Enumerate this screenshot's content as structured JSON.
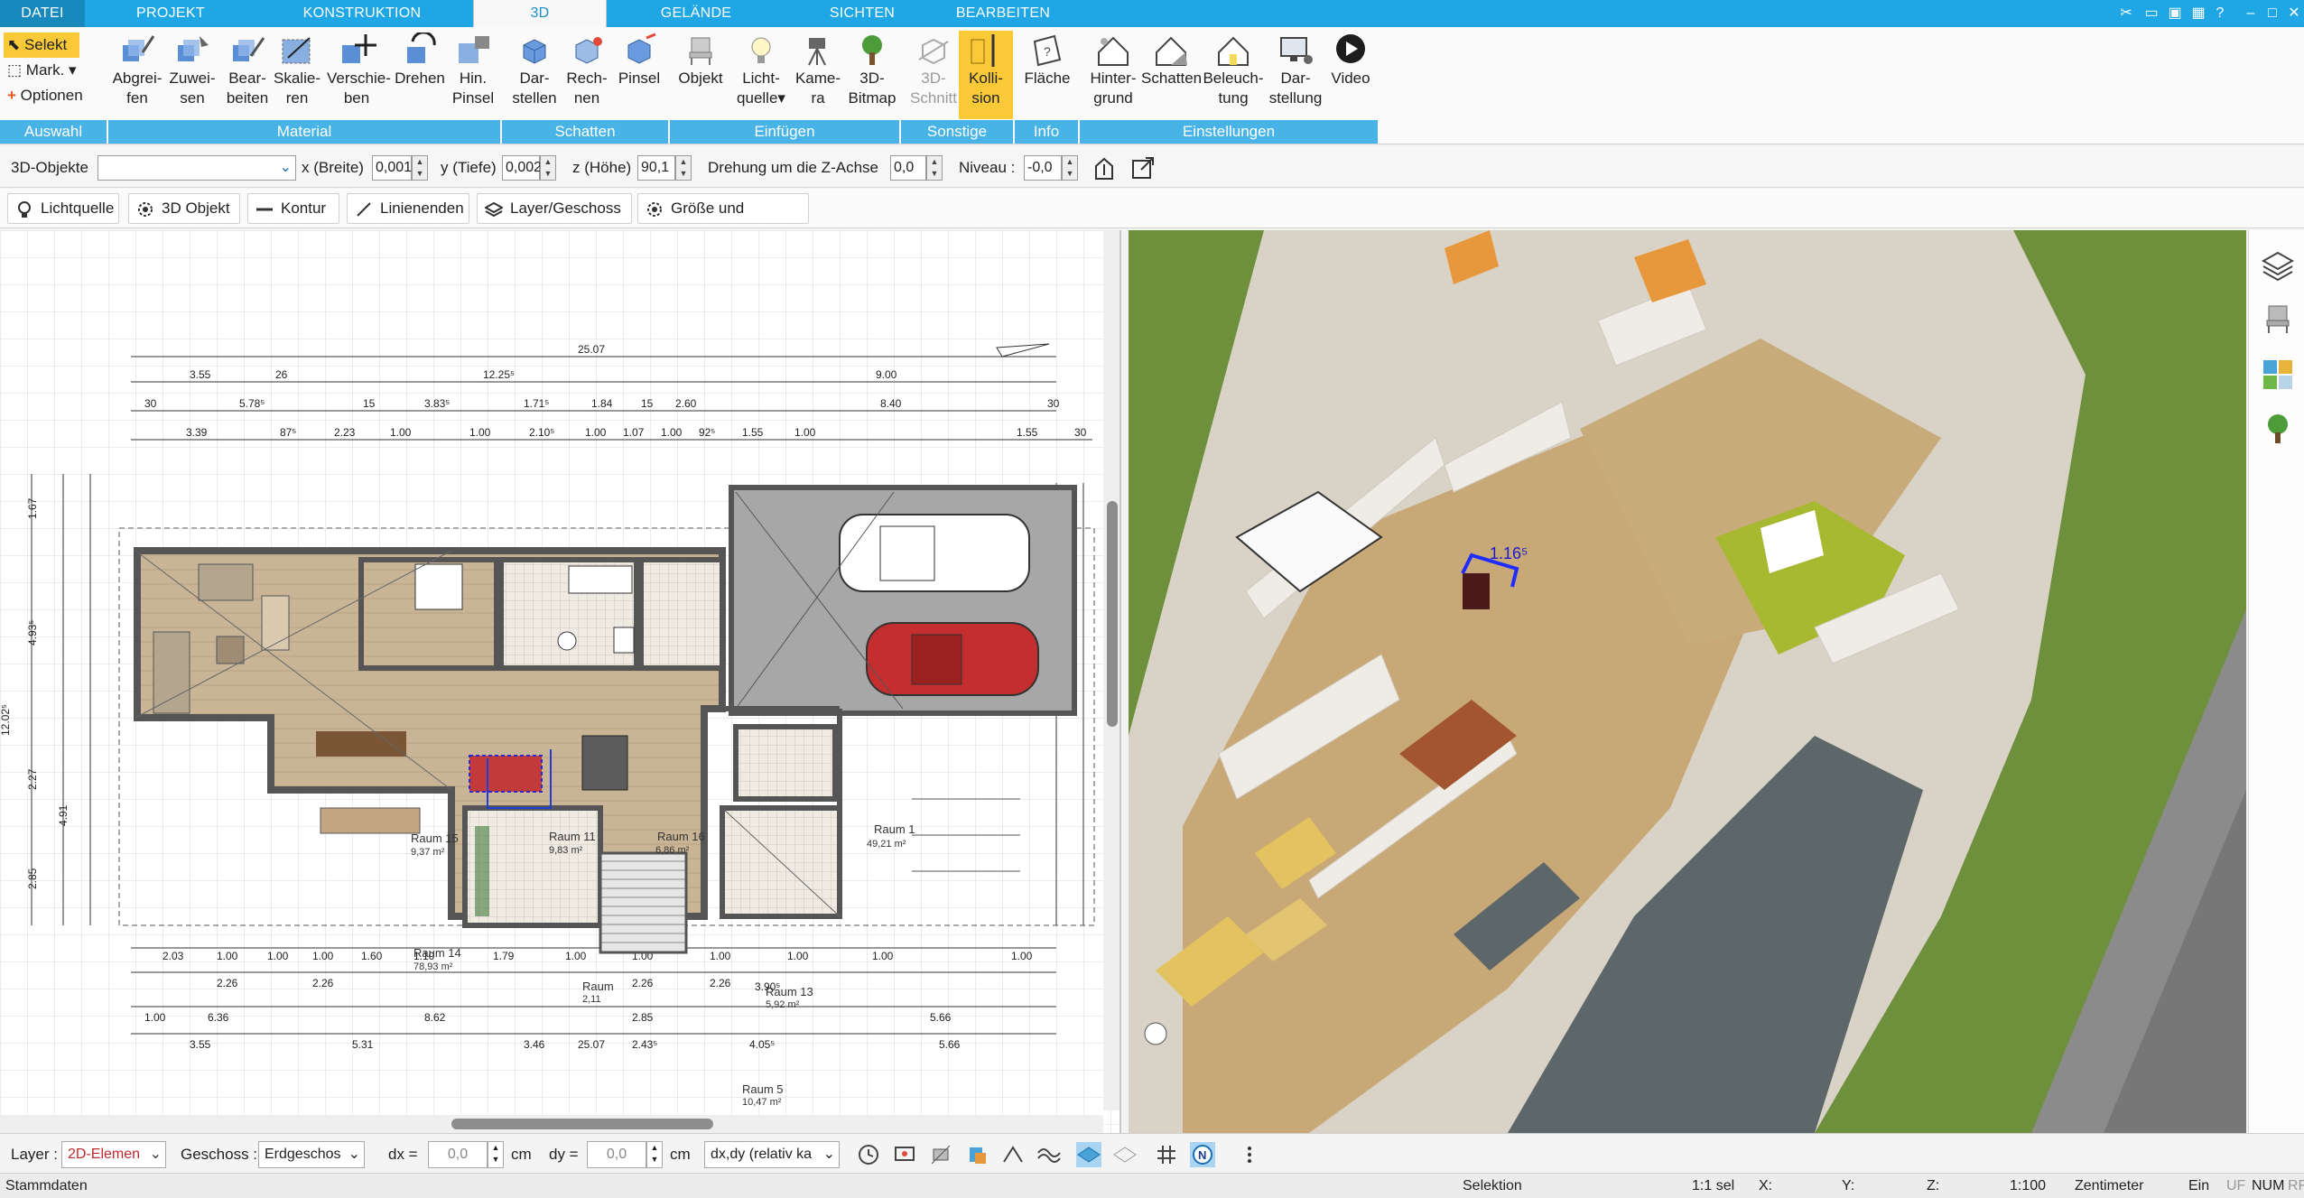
{
  "menu": {
    "tabs": [
      {
        "label": "DATEI"
      },
      {
        "label": "PROJEKT"
      },
      {
        "label": "KONSTRUKTION"
      },
      {
        "label": "3D"
      },
      {
        "label": "GELÄNDE"
      },
      {
        "label": "SICHTEN"
      },
      {
        "label": "BEARBEITEN"
      }
    ],
    "active_tab": "3D"
  },
  "ribbon": {
    "auswahl": {
      "select": "Selekt",
      "mark": "Mark.",
      "options": "Optionen",
      "group": "Auswahl"
    },
    "material": {
      "group": "Material",
      "buttons": [
        {
          "l1": "Abgrei-",
          "l2": "fen"
        },
        {
          "l1": "Zuwei-",
          "l2": "sen"
        },
        {
          "l1": "Bear-",
          "l2": "beiten"
        },
        {
          "l1": "Skalie-",
          "l2": "ren"
        },
        {
          "l1": "Verschie-",
          "l2": "ben"
        },
        {
          "l1": "Drehen",
          "l2": ""
        },
        {
          "l1": "Hin.",
          "l2": "Pinsel"
        }
      ]
    },
    "schatten": {
      "group": "Schatten",
      "buttons": [
        {
          "l1": "Dar-",
          "l2": "stellen"
        },
        {
          "l1": "Rech-",
          "l2": "nen"
        },
        {
          "l1": "Pinsel",
          "l2": ""
        }
      ]
    },
    "einfuegen": {
      "group": "Einfügen",
      "buttons": [
        {
          "l1": "Objekt",
          "l2": ""
        },
        {
          "l1": "Licht-",
          "l2": "quelle"
        },
        {
          "l1": "Kame-",
          "l2": "ra"
        },
        {
          "l1": "3D-",
          "l2": "Bitmap"
        }
      ]
    },
    "sonstige": {
      "group": "Sonstige",
      "buttons": [
        {
          "l1": "3D-",
          "l2": "Schnitt"
        },
        {
          "l1": "Kolli-",
          "l2": "sion"
        }
      ]
    },
    "info": {
      "group": "Info",
      "buttons": [
        {
          "l1": "Fläche",
          "l2": ""
        }
      ]
    },
    "einstellungen": {
      "group": "Einstellungen",
      "buttons": [
        {
          "l1": "Hinter-",
          "l2": "grund"
        },
        {
          "l1": "Schatten",
          "l2": ""
        },
        {
          "l1": "Beleuch-",
          "l2": "tung"
        },
        {
          "l1": "Dar-",
          "l2": "stellung"
        },
        {
          "l1": "Video",
          "l2": ""
        }
      ]
    }
  },
  "props": {
    "objects_label": "3D-Objekte",
    "objects_value": "",
    "x_label": "x (Breite)",
    "x_value": "0,001",
    "y_label": "y (Tiefe)",
    "y_value": "0,002",
    "z_label": "z (Höhe)",
    "z_value": "90,1",
    "rot_label": "Drehung um die Z-Achse",
    "rot_value": "0,0",
    "niveau_label": "Niveau :",
    "niveau_value": "-0,0"
  },
  "tools": [
    {
      "label": "Lichtquelle"
    },
    {
      "label": "3D Objekt"
    },
    {
      "label": "Kontur"
    },
    {
      "label": "Linienenden"
    },
    {
      "label": "Layer/Geschoss"
    },
    {
      "label": "Größe und Position"
    }
  ],
  "plan": {
    "rooms": [
      {
        "name": "Raum 1",
        "area": "49,21 m²"
      },
      {
        "name": "Raum 15",
        "area": "9,37 m²"
      },
      {
        "name": "Raum 11",
        "area": "9,83 m²"
      },
      {
        "name": "Raum 16",
        "area": "6,86 m²"
      },
      {
        "name": "Raum 14",
        "area": "78,93 m²"
      },
      {
        "name": "Raum 13",
        "area": "5,92 m²"
      },
      {
        "name": "Raum 5",
        "area": "10,47 m²"
      },
      {
        "name": "Raum",
        "area": "2,11"
      }
    ],
    "dims_top": [
      "25.07",
      "3.55",
      "26",
      "12.25⁵",
      "9.00",
      "30",
      "5.78⁵",
      "15",
      "3.83⁵",
      "1.71⁵",
      "1.84",
      "15",
      "2.60",
      "8.40",
      "30",
      "3.39",
      "87⁵",
      "2.23",
      "1.00",
      "1.00",
      "2.10⁵",
      "1.00",
      "1.07",
      "1.00",
      "92⁵",
      "1.55",
      "1.00",
      "1.55",
      "30"
    ],
    "dims_bottom": [
      "2.03",
      "1.00",
      "1.00",
      "1.00",
      "1.60",
      "1.10",
      "1.79",
      "1.00",
      "1.00",
      "1.00",
      "1.00",
      "1.00",
      "1.00",
      "2.26",
      "2.26",
      "2.26",
      "2.26",
      "3.90⁵",
      "1.00",
      "6.36",
      "8.62",
      "2.85",
      "5.66",
      "3.55",
      "5.31",
      "3.46",
      "2.43⁵",
      "4.05⁵",
      "5.66",
      "25.07"
    ],
    "dims_left": [
      "1.67",
      "4.93⁵",
      "12.02⁵",
      "2.27",
      "4.91",
      "2.85"
    ],
    "measure": "1.16⁵"
  },
  "bottom": {
    "layer_label": "Layer :",
    "layer_value": "2D-Elemen",
    "floor_label": "Geschoss :",
    "floor_value": "Erdgeschos",
    "dx_label": "dx =",
    "dx_value": "0,0",
    "cm1": "cm",
    "dy_label": "dy =",
    "dy_value": "0,0",
    "cm2": "cm",
    "mode_value": "dx,dy (relativ ka"
  },
  "status": {
    "left": "Stammdaten",
    "mode": "Selektion",
    "sel": "1:1 sel",
    "x": "X:",
    "y": "Y:",
    "z": "Z:",
    "scale": "1:100",
    "unit": "Zentimeter",
    "ein": "Ein",
    "uf": "UF",
    "num": "NUM",
    "rf": "RF"
  },
  "colors": {
    "accent": "#1ea7e4",
    "group_bar": "#47b3e6",
    "active_button": "#f9c938"
  }
}
